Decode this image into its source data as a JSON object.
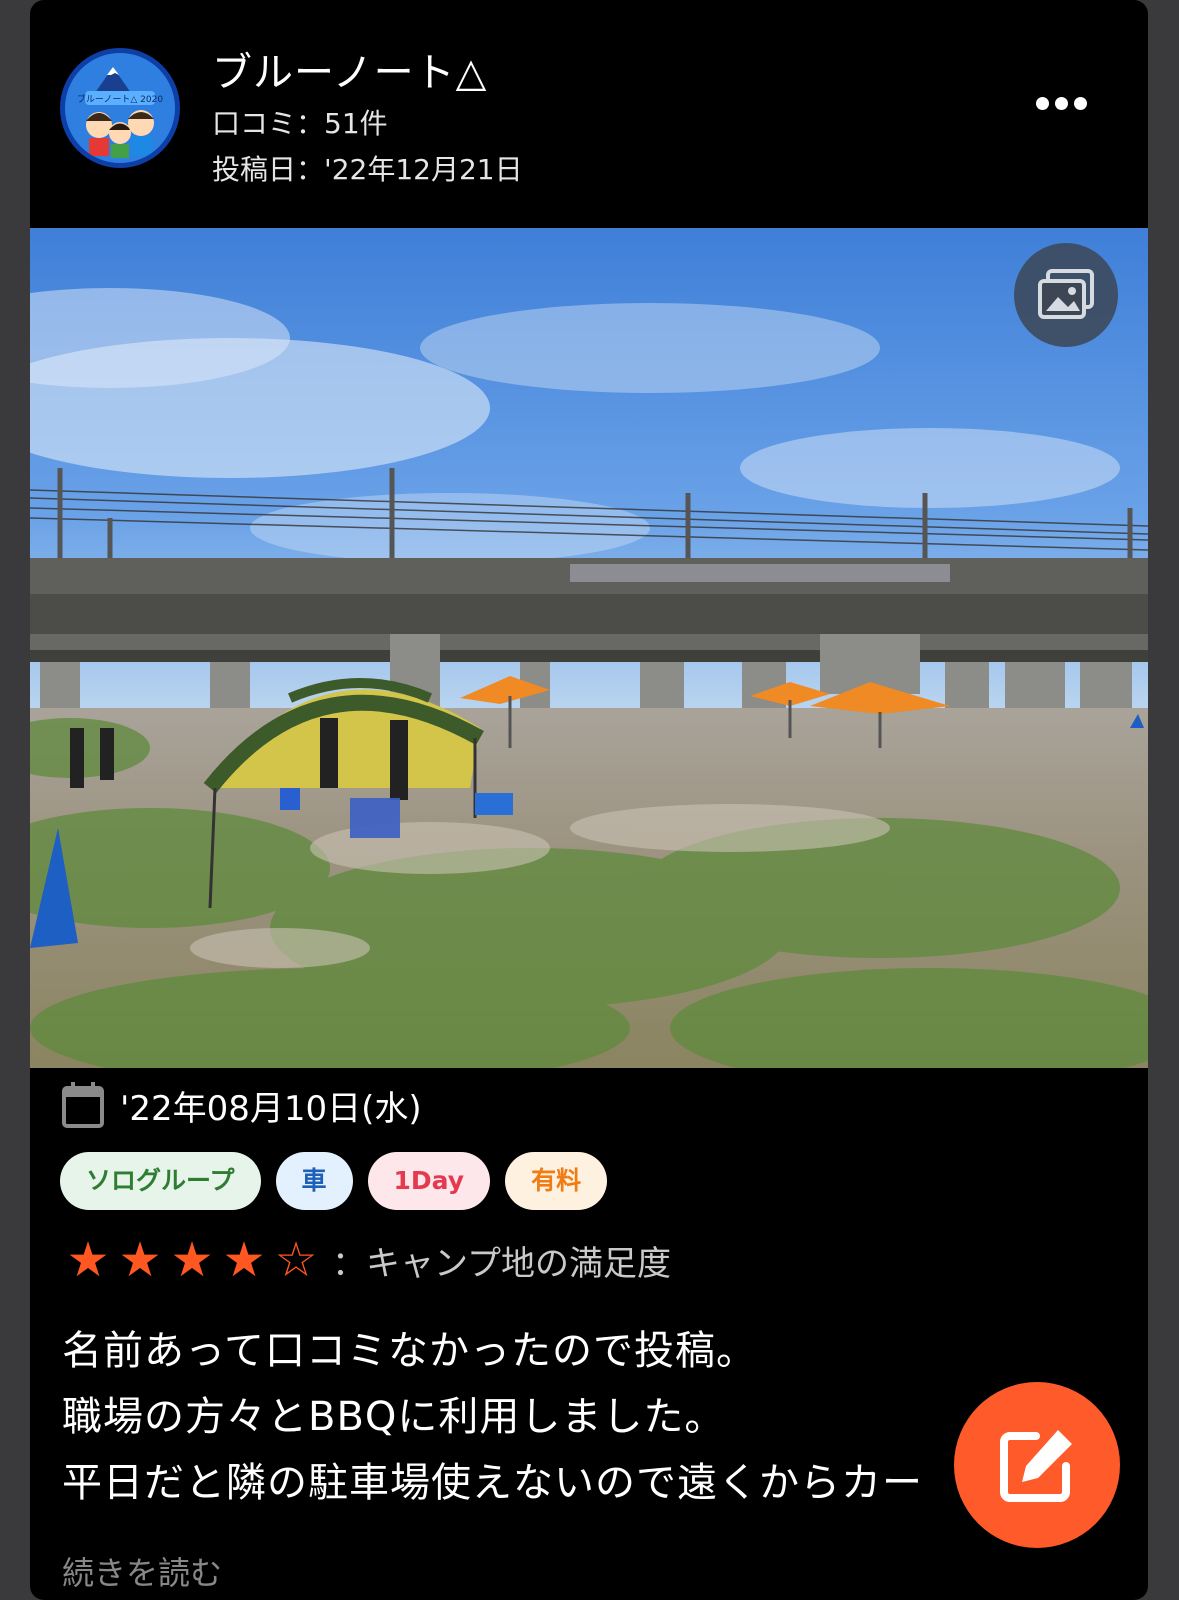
{
  "post": {
    "user_name": "ブルーノート△",
    "review_count": "口コミ：51件",
    "post_date": "投稿日：'22年12月21日",
    "avatar_text": "ブルーノート△ 2020"
  },
  "visit": {
    "date": "'22年08月10日(水)"
  },
  "tags": [
    "ソログループ",
    "車",
    "1Day",
    "有料"
  ],
  "rating": {
    "value": 4,
    "max": 5,
    "label": "：キャンプ地の満足度"
  },
  "review_text": "名前あって口コミなかったので投稿。\n職場の方々とBBQに利用しました。\n平日だと隣の駐車場使えないので遠くからカー",
  "read_more": "続きを読む",
  "icons": {
    "more": "more-horizontal-icon",
    "gallery": "gallery-icon",
    "calendar": "calendar-icon",
    "fab": "edit-icon",
    "star_filled": "star-filled-icon",
    "star_empty": "star-outline-icon"
  },
  "colors": {
    "accent": "#ff5a2a",
    "star": "#ff5722"
  }
}
